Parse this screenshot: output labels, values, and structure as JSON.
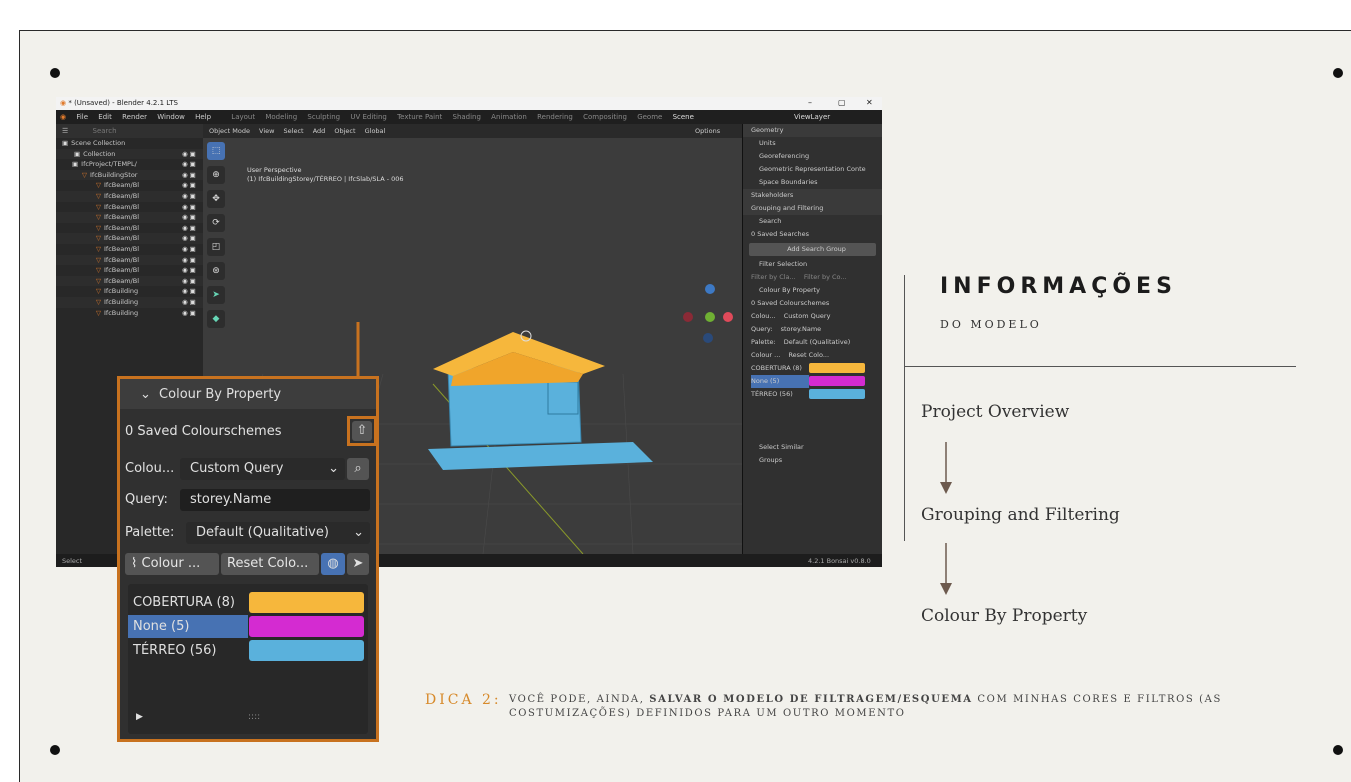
{
  "blender": {
    "window_title": "* (Unsaved) - Blender 4.2.1 LTS",
    "menus": [
      "File",
      "Edit",
      "Render",
      "Window",
      "Help"
    ],
    "workspaces": [
      "Layout",
      "Modeling",
      "Sculpting",
      "UV Editing",
      "Texture Paint",
      "Shading",
      "Animation",
      "Rendering",
      "Compositing",
      "Geome"
    ],
    "scene": "Scene",
    "view_layer": "ViewLayer",
    "outliner": {
      "search_placeholder": "Search",
      "rows": [
        "Scene Collection",
        "Collection",
        "IfcProject/TEMPL/",
        "IfcBuildingStor",
        "IfcBeam/Bl",
        "IfcBeam/Bl",
        "IfcBeam/Bl",
        "IfcBeam/Bl",
        "IfcBeam/Bl",
        "IfcBeam/Bl",
        "IfcBeam/Bl",
        "IfcBeam/Bl",
        "IfcBeam/Bl",
        "IfcBeam/Bl",
        "IfcBuilding",
        "IfcBuilding",
        "IfcBuilding"
      ]
    },
    "viewport": {
      "mode": "Object Mode",
      "header_items": [
        "View",
        "Select",
        "Add",
        "Object"
      ],
      "transform": "Global",
      "options": "Options",
      "info_line1": "User Perspective",
      "info_line2": "(1) IfcBuildingStorey/TÉRREO | IfcSlab/SLA - 006"
    },
    "properties": {
      "rows": [
        "Geometry",
        "Units",
        "Georeferencing",
        "Geometric Representation Conte",
        "Space Boundaries",
        "Stakeholders",
        "Grouping and Filtering",
        "Search",
        "0 Saved Searches",
        "Add Search Group",
        "Filter Selection",
        "Filter by Cla...",
        "Filter by Co...",
        "Colour By Property",
        "0 Saved Colourschemes",
        "Colou...",
        "Custom Query",
        "Query:",
        "storey.Name",
        "Palette:",
        "Default (Qualitative)",
        "Colour ...",
        "Reset Colo...",
        "COBERTURA (8)",
        "None (5)",
        "TÉRREO (56)",
        "Select Similar",
        "Groups"
      ]
    },
    "status_left": "Select",
    "version": "4.2.1  Bonsai v0.8.0"
  },
  "callout": {
    "section": "Colour By Property",
    "saved": "0 Saved Colourschemes",
    "colour_label": "Colou...",
    "colour_value": "Custom Query",
    "query_label": "Query:",
    "query_value": "storey.Name",
    "palette_label": "Palette:",
    "palette_value": "Default (Qualitative)",
    "btn_colour": "Colour ...",
    "btn_reset": "Reset Colo...",
    "items": [
      {
        "label": "COBERTURA (8)",
        "color": "#f6b73c"
      },
      {
        "label": "None (5)",
        "color": "#d42bd1"
      },
      {
        "label": "TÉRREO (56)",
        "color": "#5ab1dc"
      }
    ],
    "grip": "::::"
  },
  "panel": {
    "title": "INFORMAÇÕES",
    "subtitle": "DO MODELO",
    "steps": [
      "Project Overview",
      "Grouping and Filtering",
      "Colour By Property"
    ]
  },
  "tip": {
    "label": "DICA 2:",
    "text_a": "VOCÊ PODE, AINDA, ",
    "text_b": "SALVAR O MODELO DE FILTRAGEM/ESQUEMA",
    "text_c": " COM MINHAS CORES E FILTROS (AS COSTUMIZAÇÕES) DEFINIDOS PARA UM OUTRO MOMENTO"
  },
  "colors": {
    "accent": "#c8721f",
    "tip_label": "#d78a2b",
    "roof": "#f6b73c",
    "walls": "#5ab1dc"
  }
}
